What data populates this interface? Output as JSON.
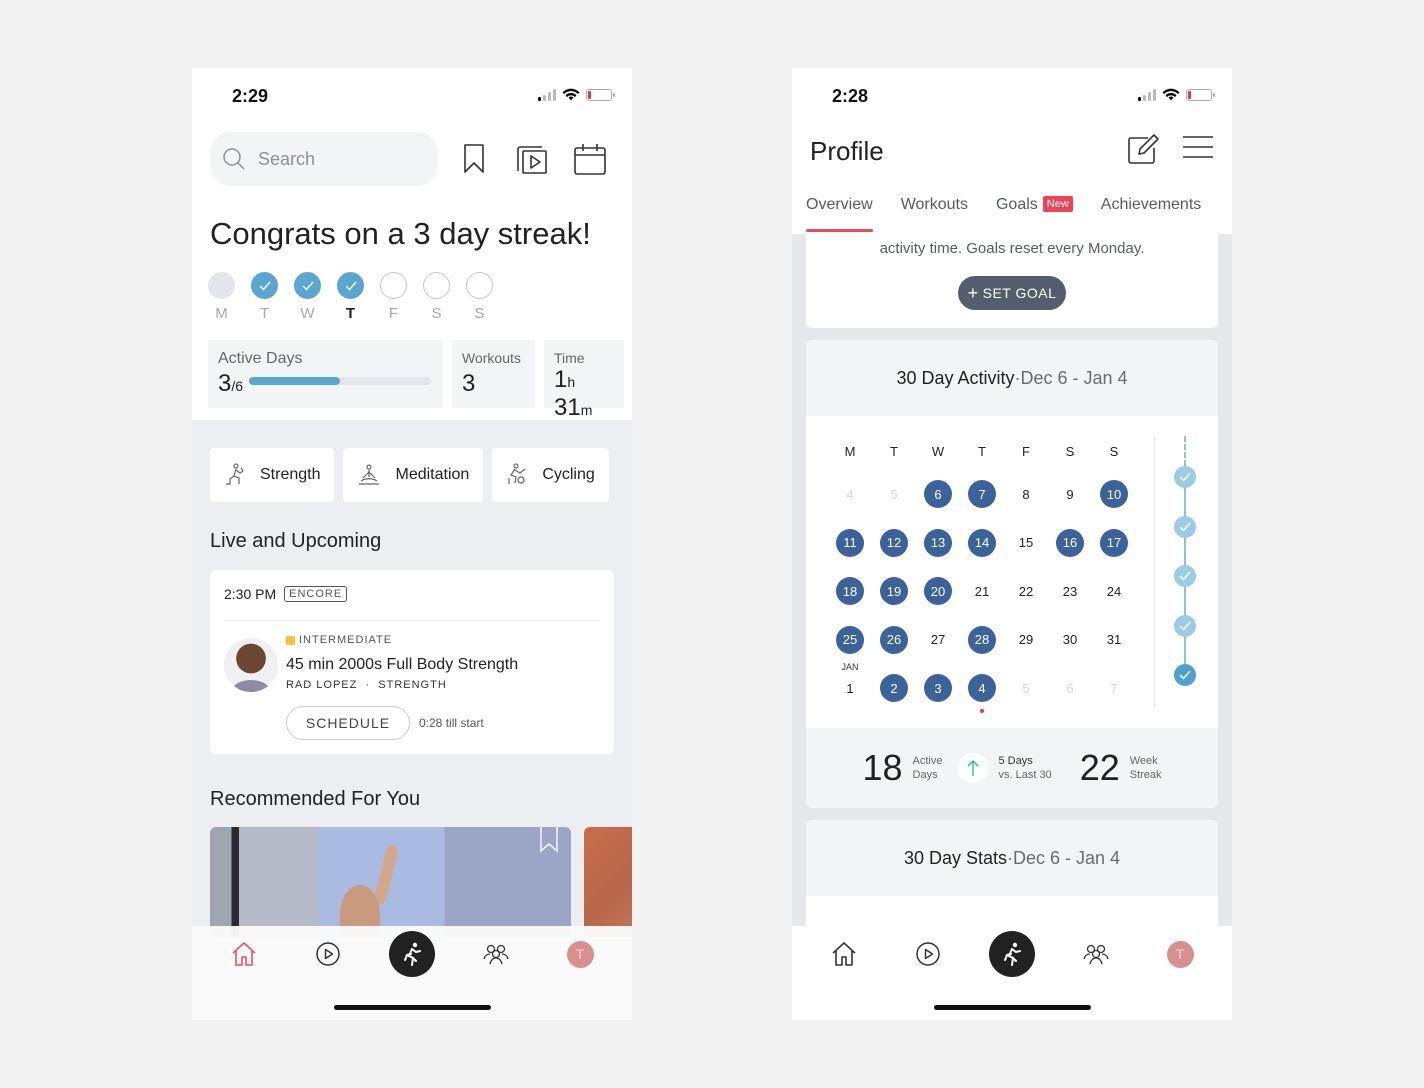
{
  "home": {
    "status": {
      "time": "2:29"
    },
    "search": {
      "placeholder": "Search"
    },
    "congrats": "Congrats on a 3 day streak!",
    "week": [
      {
        "label": "M",
        "state": "past"
      },
      {
        "label": "T",
        "state": "done"
      },
      {
        "label": "W",
        "state": "done"
      },
      {
        "label": "T",
        "state": "done",
        "today": true
      },
      {
        "label": "F",
        "state": "empty"
      },
      {
        "label": "S",
        "state": "empty"
      },
      {
        "label": "S",
        "state": "empty"
      }
    ],
    "stats": {
      "active_days_label": "Active Days",
      "active_days_value": "3",
      "active_days_total": "/6",
      "active_days_fraction": 0.5,
      "workouts_label": "Workouts",
      "workouts_value": "3",
      "time_label": "Time",
      "time_hours": "1",
      "time_h_unit": "h",
      "time_minutes": "31",
      "time_m_unit": "m"
    },
    "categories": [
      {
        "label": "Strength",
        "icon": "strength-icon"
      },
      {
        "label": "Meditation",
        "icon": "meditation-icon"
      },
      {
        "label": "Cycling",
        "icon": "cycling-icon"
      }
    ],
    "live_title": "Live and Upcoming",
    "live_class": {
      "time": "2:30 PM",
      "badge": "ENCORE",
      "level": "INTERMEDIATE",
      "level_color": "#f3c33b",
      "title": "45 min 2000s Full Body Strength",
      "instructor": "RAD LOPEZ",
      "separator": "·",
      "discipline": "STRENGTH",
      "schedule_label": "SCHEDULE",
      "countdown": "0:28 till start"
    },
    "recommended_title": "Recommended For You",
    "tabbar": {
      "avatar_initial": "T",
      "active": "home",
      "active_color": "#e8506a"
    }
  },
  "profile": {
    "status": {
      "time": "2:28"
    },
    "title": "Profile",
    "tabs": [
      {
        "label": "Overview",
        "active": true
      },
      {
        "label": "Workouts"
      },
      {
        "label": "Goals",
        "badge": "New"
      },
      {
        "label": "Achievements"
      }
    ],
    "goal_text": "activity time. Goals reset every Monday.",
    "set_goal_label": "SET GOAL",
    "activity": {
      "title": "30 Day Activity",
      "separator": " · ",
      "range": "Dec 6 - Jan 4",
      "weekday_headers": [
        "M",
        "T",
        "W",
        "T",
        "F",
        "S",
        "S"
      ],
      "weeks": [
        [
          {
            "d": "4",
            "s": "dim"
          },
          {
            "d": "5",
            "s": "dim"
          },
          {
            "d": "6",
            "s": "act"
          },
          {
            "d": "7",
            "s": "act"
          },
          {
            "d": "8"
          },
          {
            "d": "9"
          },
          {
            "d": "10",
            "s": "act"
          }
        ],
        [
          {
            "d": "11",
            "s": "act"
          },
          {
            "d": "12",
            "s": "act"
          },
          {
            "d": "13",
            "s": "act"
          },
          {
            "d": "14",
            "s": "act"
          },
          {
            "d": "15"
          },
          {
            "d": "16",
            "s": "act"
          },
          {
            "d": "17",
            "s": "act"
          }
        ],
        [
          {
            "d": "18",
            "s": "act"
          },
          {
            "d": "19",
            "s": "act"
          },
          {
            "d": "20",
            "s": "act"
          },
          {
            "d": "21"
          },
          {
            "d": "22"
          },
          {
            "d": "23"
          },
          {
            "d": "24"
          }
        ],
        [
          {
            "d": "25",
            "s": "act"
          },
          {
            "d": "26",
            "s": "act"
          },
          {
            "d": "27"
          },
          {
            "d": "28",
            "s": "act"
          },
          {
            "d": "29"
          },
          {
            "d": "30"
          },
          {
            "d": "31"
          }
        ],
        [
          {
            "d": "1",
            "month": "JAN"
          },
          {
            "d": "2",
            "s": "act"
          },
          {
            "d": "3",
            "s": "act"
          },
          {
            "d": "4",
            "s": "act",
            "today": true
          },
          {
            "d": "5",
            "s": "dim"
          },
          {
            "d": "6",
            "s": "dim"
          },
          {
            "d": "7",
            "s": "dim"
          }
        ]
      ],
      "week_streak_checks": 5,
      "active_days_value": "18",
      "active_days_label1": "Active",
      "active_days_label2": "Days",
      "delta_value": "5 Days",
      "delta_label": "vs. Last 30",
      "week_streak_value": "22",
      "week_streak_label1": "Week",
      "week_streak_label2": "Streak"
    },
    "stats": {
      "title": "30 Day Stats",
      "separator": " · ",
      "range": "Dec 6 - Jan 4"
    },
    "tabbar": {
      "avatar_initial": "T"
    }
  },
  "colors": {
    "accent_blue": "#3b629b",
    "streak_blue": "#5aa6d1",
    "tab_underline": "#e84a5f",
    "new_badge": "#f04257"
  }
}
